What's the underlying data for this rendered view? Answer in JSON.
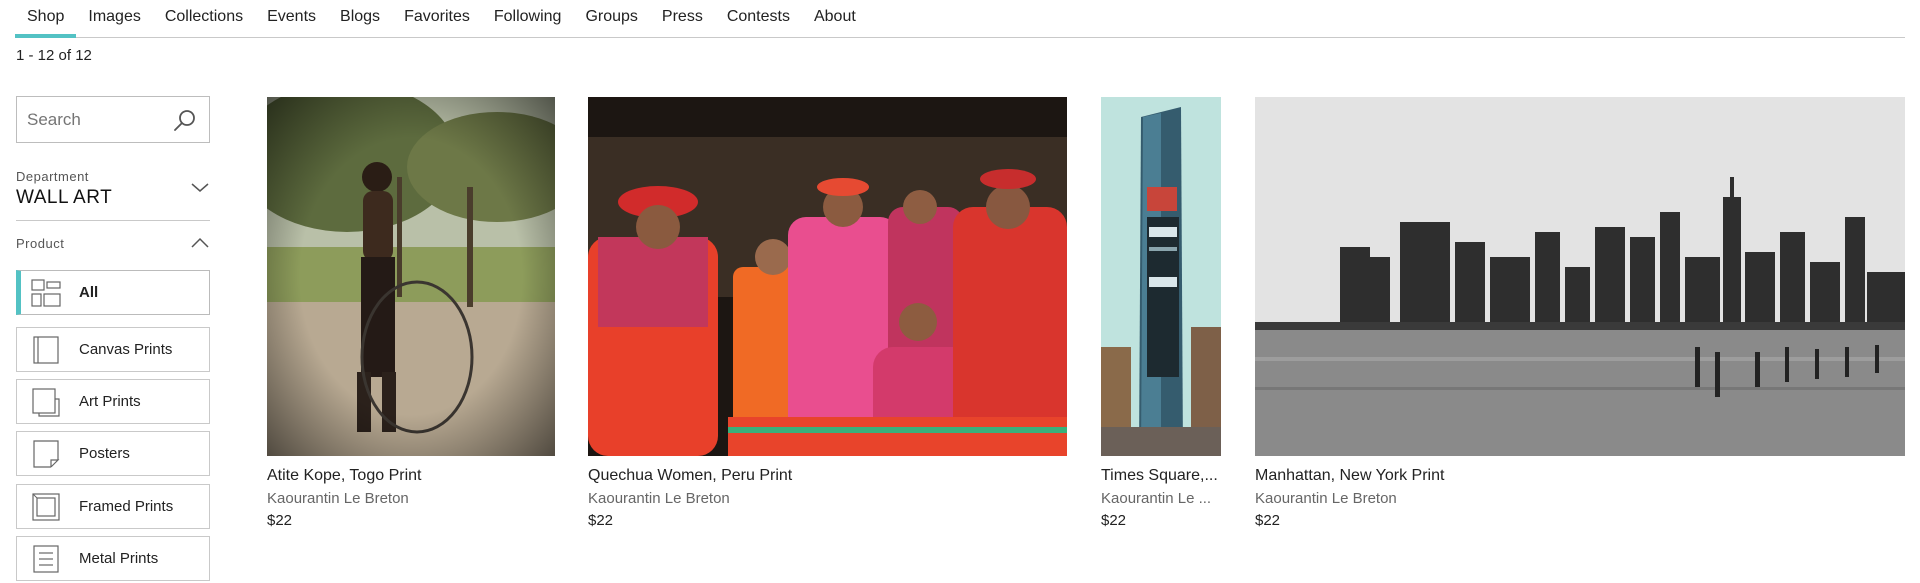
{
  "nav": {
    "tabs": [
      "Shop",
      "Images",
      "Collections",
      "Events",
      "Blogs",
      "Favorites",
      "Following",
      "Groups",
      "Press",
      "Contests",
      "About"
    ],
    "active": "Shop"
  },
  "results": {
    "count_text": "1 - 12 of 12"
  },
  "sidebar": {
    "search": {
      "placeholder": "Search",
      "value": ""
    },
    "department": {
      "label": "Department",
      "value": "WALL ART"
    },
    "product": {
      "label": "Product",
      "items": [
        {
          "label": "All",
          "active": true
        },
        {
          "label": "Canvas Prints"
        },
        {
          "label": "Art Prints"
        },
        {
          "label": "Posters"
        },
        {
          "label": "Framed Prints"
        },
        {
          "label": "Metal Prints"
        }
      ]
    }
  },
  "products": [
    {
      "title": "Atite Kope, Togo Print",
      "artist": "Kaourantin Le Breton",
      "price": "$22"
    },
    {
      "title": "Quechua Women, Peru Print",
      "artist": "Kaourantin Le Breton",
      "price": "$22"
    },
    {
      "title": "Times Square,...",
      "artist": "Kaourantin Le ...",
      "price": "$22"
    },
    {
      "title": "Manhattan, New York Print",
      "artist": "Kaourantin Le Breton",
      "price": "$22"
    }
  ],
  "colors": {
    "accent": "#53c2c4"
  }
}
